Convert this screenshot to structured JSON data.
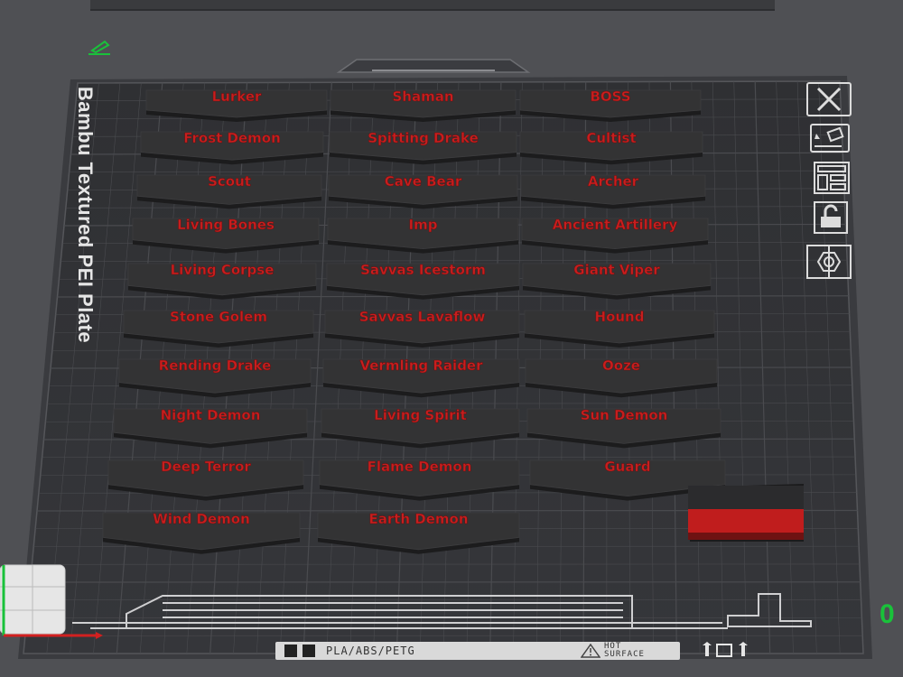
{
  "plate": {
    "name": "Bambu Textured PEI Plate",
    "material_label": "PLA/ABS/PETG",
    "hot_surface_label": [
      "HOT",
      "SURFACE"
    ]
  },
  "axis_indicator_value": "0",
  "colors": {
    "background": "#4f5054",
    "plate_surface": "#303134",
    "grid_line": "#4a4b4f",
    "tile_top": "#333334",
    "tile_side": "#1c1c1d",
    "label_red": "#c81e1e",
    "accent_green": "#19c23a"
  },
  "icons": {
    "edit": "pencil-icon",
    "remove": "close-icon",
    "auto_orient": "auto-orient-icon",
    "arrange": "arrange-icon",
    "lock": "unlock-icon",
    "settings": "settings-hexagon-icon"
  },
  "tiles": [
    "Lurker",
    "Shaman",
    "BOSS",
    "Frost Demon",
    "Spitting Drake",
    "Cultist",
    "Scout",
    "Cave Bear",
    "Archer",
    "Living Bones",
    "Imp",
    "Ancient Artillery",
    "Living Corpse",
    "Savvas Icestorm",
    "Giant Viper",
    "Stone Golem",
    "Savvas Lavaflow",
    "Hound",
    "Rending Drake",
    "Vermling Raider",
    "Ooze",
    "Night Demon",
    "Living Spirit",
    "Sun Demon",
    "Deep Terror",
    "Flame Demon",
    "Guard",
    "Wind Demon",
    "Earth Demon"
  ]
}
